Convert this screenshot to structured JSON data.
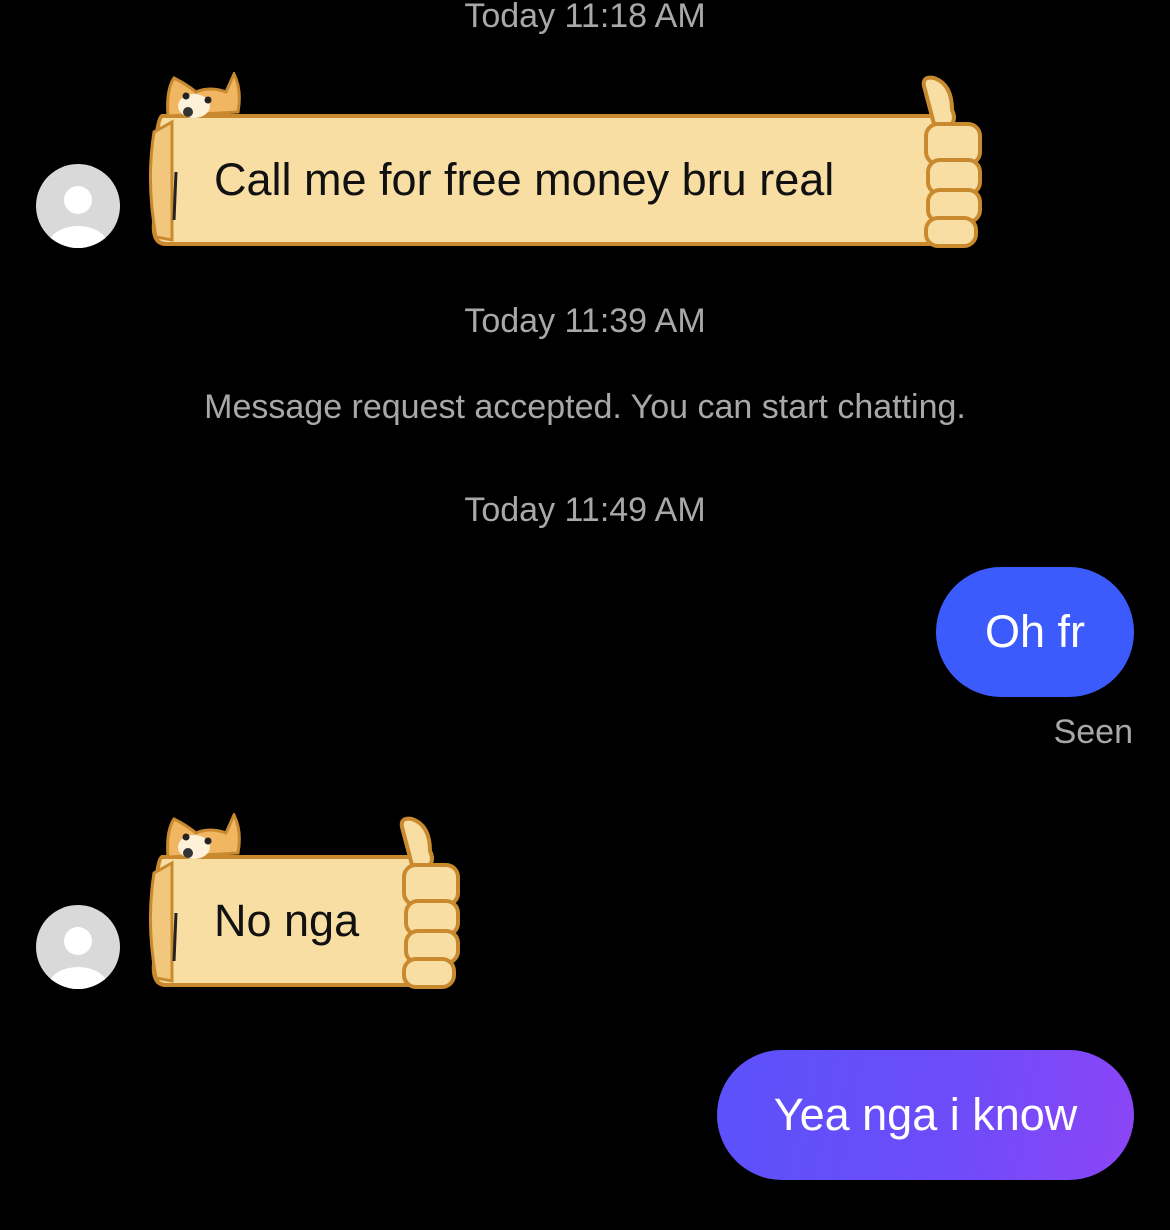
{
  "conversation": {
    "timestamps": [
      "Today 11:18 AM",
      "Today 11:39 AM",
      "Today 11:49 AM"
    ],
    "system_note": "Message request accepted. You can start chatting.",
    "messages": [
      {
        "direction": "received",
        "text": "Call me for free money bru real",
        "bubble_style": "doge-thumbs-up"
      },
      {
        "direction": "sent",
        "text": "Oh fr",
        "status": "Seen"
      },
      {
        "direction": "received",
        "text": "No nga",
        "bubble_style": "doge-thumbs-up"
      },
      {
        "direction": "sent",
        "text": "Yea nga i know"
      }
    ],
    "avatar_icon": "default-person-icon"
  },
  "colors": {
    "background": "#000000",
    "meta_text": "#a8a8a8",
    "doge_scroll": "#f8dea3",
    "doge_outline": "#c98a2f",
    "sent_blue": "#3b5bfd",
    "sent_gradient_end": "#8c45f6"
  }
}
